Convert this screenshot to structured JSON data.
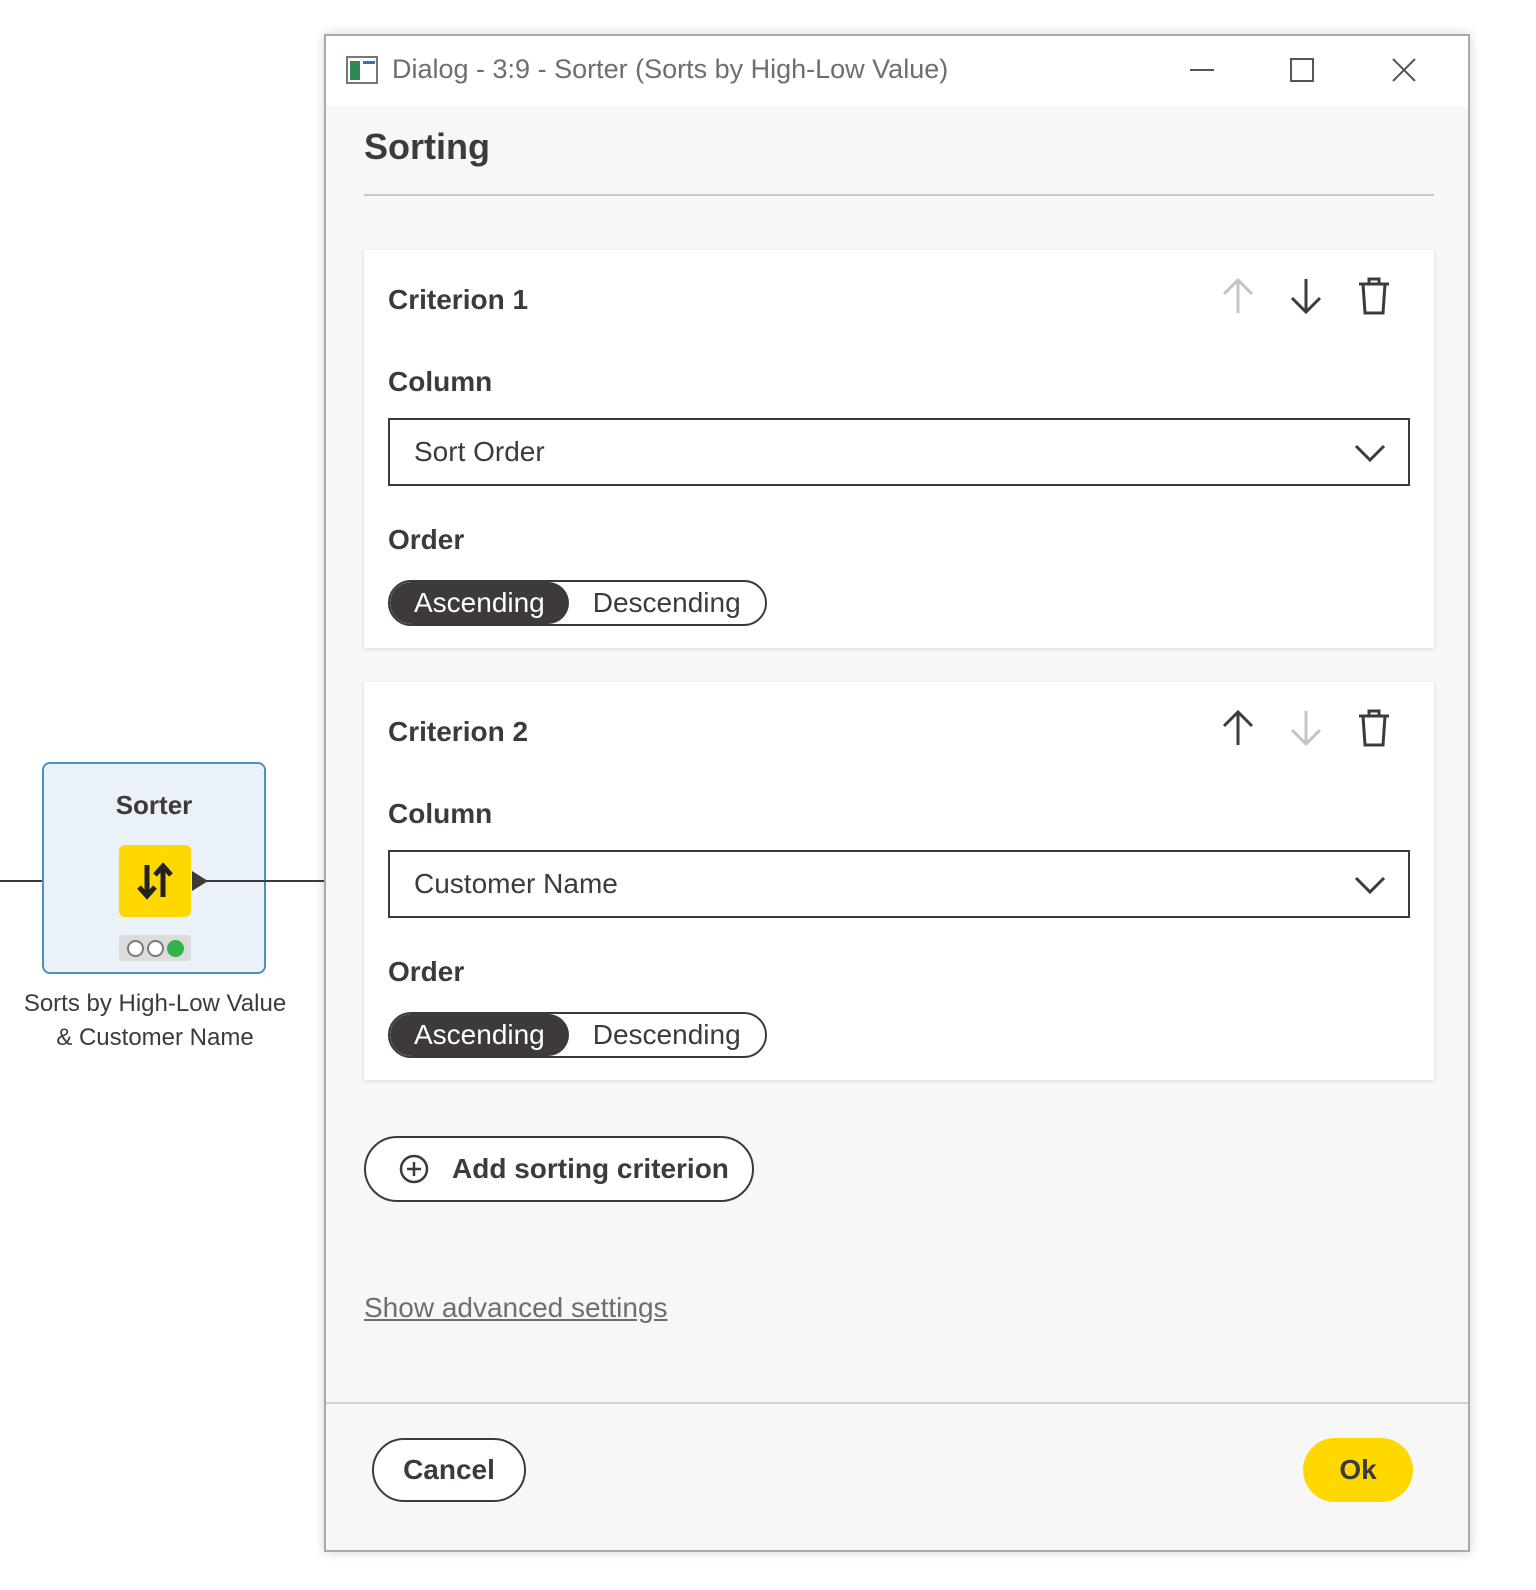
{
  "node": {
    "title": "Sorter",
    "label_line1": "Sorts by High-Low Value",
    "label_line2": "& Customer Name",
    "icon": "sort-arrows-icon",
    "status": [
      "inactive",
      "inactive",
      "executed-green"
    ]
  },
  "dialog": {
    "window_title": "Dialog - 3:9 - Sorter (Sorts by High-Low Value)",
    "heading": "Sorting",
    "criteria": [
      {
        "title": "Criterion 1",
        "column_label": "Column",
        "column_value": "Sort Order",
        "order_label": "Order",
        "ascending_label": "Ascending",
        "descending_label": "Descending",
        "selected_order": "Ascending",
        "move_up_enabled": false,
        "move_down_enabled": true
      },
      {
        "title": "Criterion 2",
        "column_label": "Column",
        "column_value": "Customer Name",
        "order_label": "Order",
        "ascending_label": "Ascending",
        "descending_label": "Descending",
        "selected_order": "Ascending",
        "move_up_enabled": true,
        "move_down_enabled": false
      }
    ],
    "add_criterion_label": "Add sorting criterion",
    "advanced_link": "Show advanced settings",
    "cancel_label": "Cancel",
    "ok_label": "Ok"
  },
  "colors": {
    "accent_yellow": "#ffd800",
    "dark": "#3e3a39",
    "node_border": "#4f90c4",
    "status_green": "#2fb34a"
  }
}
